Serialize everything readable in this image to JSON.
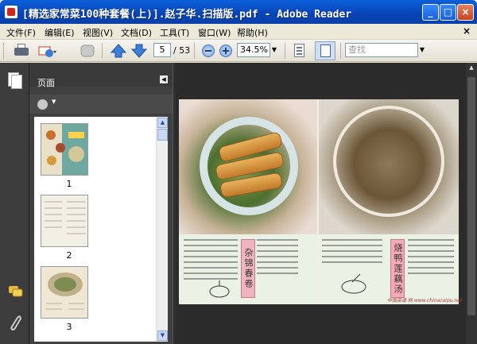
{
  "window": {
    "title": "[精选家常菜100种套餐(上)].赵子华.扫描版.pdf - Adobe Reader",
    "controls": [
      "_",
      "□",
      "×"
    ]
  },
  "menu": {
    "items": [
      "文件(F)",
      "编辑(E)",
      "视图(V)",
      "文档(D)",
      "工具(T)",
      "窗口(W)",
      "帮助(H)"
    ],
    "close_doc": "×"
  },
  "toolbar": {
    "page_current": "5",
    "page_total": "/ 53",
    "zoom": "34.5%",
    "search_placeholder": "查找"
  },
  "panel": {
    "title": "页面",
    "thumbnails": [
      {
        "label": "1"
      },
      {
        "label": "2"
      },
      {
        "label": "3"
      }
    ]
  },
  "document": {
    "left_banner": "杂锦春卷",
    "right_banner": "烧鸭莲藕汤",
    "footer": "中国菜谱 网 www.chinacaipu.net"
  },
  "icons": {
    "printer": "printer-icon",
    "email": "email-icon",
    "hand": "hand-icon",
    "prev": "previous-page-icon",
    "next": "next-page-icon",
    "zoom_out": "zoom-out-icon",
    "zoom_in": "zoom-in-icon",
    "fit": "fit-page-icon",
    "fullscreen": "fullscreen-icon",
    "gear": "gear-icon",
    "comment": "comment-icon",
    "attach": "paperclip-icon"
  }
}
